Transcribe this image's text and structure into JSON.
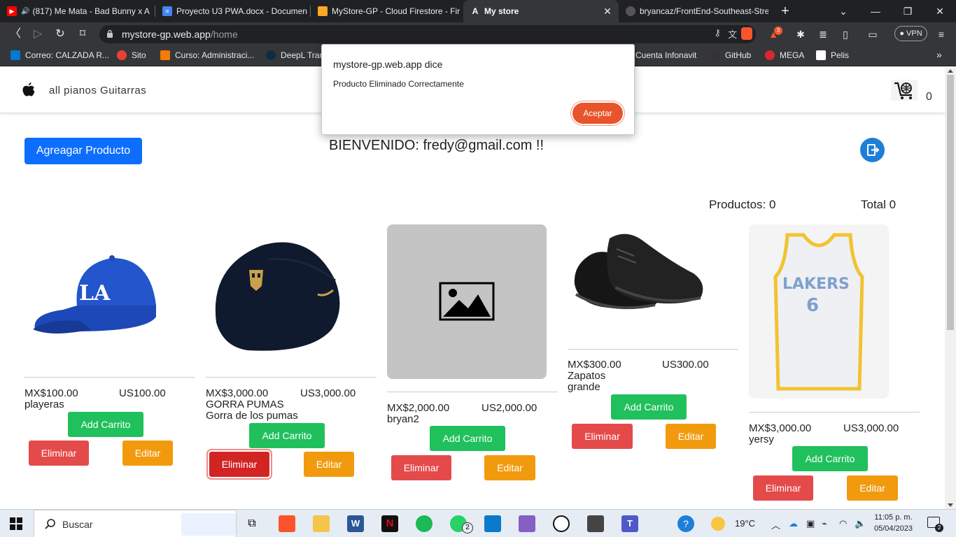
{
  "browser": {
    "tabs": [
      {
        "title": "(817) Me Mata - Bad Bunny x A",
        "icon": "youtube-icon",
        "color": "#ff0000",
        "active": false
      },
      {
        "title": "Proyecto U3 PWA.docx - Documen",
        "icon": "docs-icon",
        "color": "#4285f4",
        "active": false
      },
      {
        "title": "MyStore-GP - Cloud Firestore - Fir",
        "icon": "firebase-icon",
        "color": "#f9a825",
        "active": false
      },
      {
        "title": "My store",
        "icon": "angular-icon",
        "color": "#ffffff",
        "active": true
      },
      {
        "title": "bryancaz/FrontEnd-Southeast-Stre",
        "icon": "github-icon",
        "color": "#ffffff",
        "active": false
      }
    ],
    "url_host": "mystore-gp.web.app",
    "url_path": "/home",
    "vpn_label": "VPN",
    "brave_badge": "3",
    "bookmarks": [
      {
        "label": "Correo: CALZADA R...",
        "color": "#0078d4"
      },
      {
        "label": "Sito",
        "color": "#e94235"
      },
      {
        "label": "Curso: Administraci...",
        "color": "#f57c00"
      },
      {
        "label": "DeepL Tran",
        "color": "#0f2b46"
      },
      {
        "label": "Cuenta Infonavit",
        "color": "#d32f2f"
      },
      {
        "label": "GitHub",
        "color": "#333333"
      },
      {
        "label": "MEGA",
        "color": "#d9272e"
      },
      {
        "label": "Pelis",
        "color": "#ffffff"
      }
    ]
  },
  "navbar": {
    "brand": "all pianos Guitarras",
    "cart_count": "0"
  },
  "page": {
    "add_product_label": "Agreagar Producto",
    "welcome": "BIENVENIDO: fredy@gmail.com !!",
    "productos_label": "Productos: 0",
    "total_label": "Total 0"
  },
  "products": [
    {
      "price_mx": "MX$100.00",
      "price_us": "US100.00",
      "name": "playeras",
      "description": "",
      "image": "dodgers-cap"
    },
    {
      "price_mx": "MX$3,000.00",
      "price_us": "US3,000.00",
      "name": "GORRA PUMAS",
      "description": "Gorra de los pumas",
      "image": "pumas-cap"
    },
    {
      "price_mx": "MX$2,000.00",
      "price_us": "US2,000.00",
      "name": "bryan2",
      "description": "",
      "image": "placeholder"
    },
    {
      "price_mx": "MX$300.00",
      "price_us": "US300.00",
      "name": "Zapatos",
      "description": "grande",
      "image": "shoes"
    },
    {
      "price_mx": "MX$3,000.00",
      "price_us": "US3,000.00",
      "name": "yersy",
      "description": "",
      "image": "lakers-jersey"
    }
  ],
  "buttons": {
    "add_cart": "Add Carrito",
    "delete": "Eliminar",
    "edit": "Editar"
  },
  "dialog": {
    "title": "mystore-gp.web.app dice",
    "message": "Producto Eliminado Correctamente",
    "accept": "Aceptar"
  },
  "taskbar": {
    "search_placeholder": "Buscar",
    "weather": "19°C",
    "time": "11:05 p. m.",
    "date": "05/04/2023",
    "notifications": "2",
    "whatsapp_badge": "2"
  }
}
